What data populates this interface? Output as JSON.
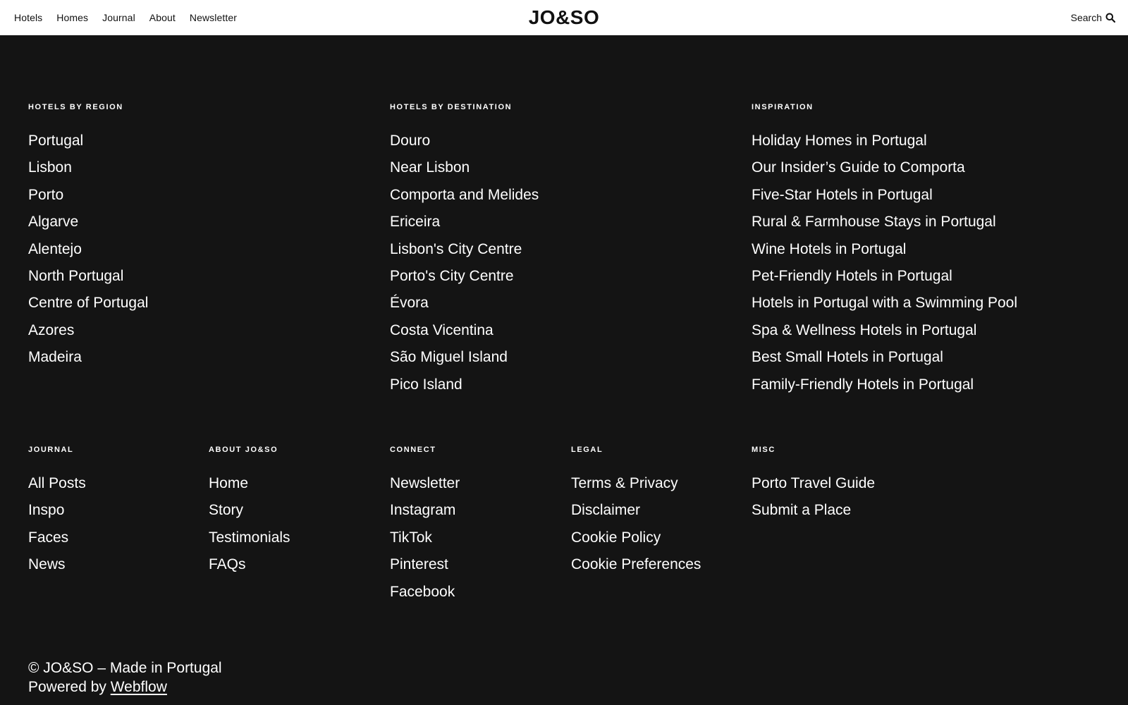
{
  "nav": {
    "items": [
      "Hotels",
      "Homes",
      "Journal",
      "About",
      "Newsletter"
    ],
    "logo": "JO&SO",
    "search_label": "Search",
    "search_icon": "search-icon"
  },
  "footer": {
    "hotels_by_region": {
      "heading": "HOTELS BY REGION",
      "items": [
        "Portugal",
        "Lisbon",
        "Porto",
        "Algarve",
        "Alentejo",
        "North Portugal",
        "Centre of Portugal",
        "Azores",
        "Madeira"
      ]
    },
    "hotels_by_destination": {
      "heading": "HOTELS BY DESTINATION",
      "items": [
        "Douro",
        "Near Lisbon",
        "Comporta and Melides",
        "Ericeira",
        "Lisbon's City Centre",
        "Porto's City Centre",
        "Évora",
        "Costa Vicentina",
        "São Miguel Island",
        "Pico Island"
      ]
    },
    "inspiration": {
      "heading": "INSPIRATION",
      "items": [
        "Holiday Homes in Portugal",
        "Our Insider’s Guide to Comporta",
        "Five-Star Hotels in Portugal",
        "Rural & Farmhouse Stays in Portugal",
        "Wine Hotels in Portugal",
        "Pet-Friendly Hotels in Portugal",
        "Hotels in Portugal with a Swimming Pool",
        "Spa & Wellness Hotels in Portugal",
        "Best Small Hotels in Portugal",
        "Family-Friendly Hotels in Portugal"
      ]
    },
    "journal": {
      "heading": "JOURNAL",
      "items": [
        "All Posts",
        "Inspo",
        "Faces",
        "News"
      ]
    },
    "about": {
      "heading": "ABOUT JO&SO",
      "items": [
        "Home",
        "Story",
        "Testimonials",
        "FAQs"
      ]
    },
    "connect": {
      "heading": "CONNECT",
      "items": [
        "Newsletter",
        "Instagram",
        "TikTok",
        "Pinterest",
        "Facebook"
      ]
    },
    "legal": {
      "heading": "LEGAL",
      "items": [
        "Terms & Privacy",
        "Disclaimer",
        "Cookie Policy",
        "Cookie Preferences"
      ]
    },
    "misc": {
      "heading": "MISC",
      "items": [
        "Porto Travel Guide",
        "Submit a Place"
      ]
    },
    "copyright": "© JO&SO – Made in Portugal",
    "powered_prefix": "Powered by",
    "powered_link": "Webflow"
  },
  "colors": {
    "background": "#141414",
    "topbar": "#ffffff",
    "text": "#ffffff",
    "nav_text": "#111111"
  }
}
